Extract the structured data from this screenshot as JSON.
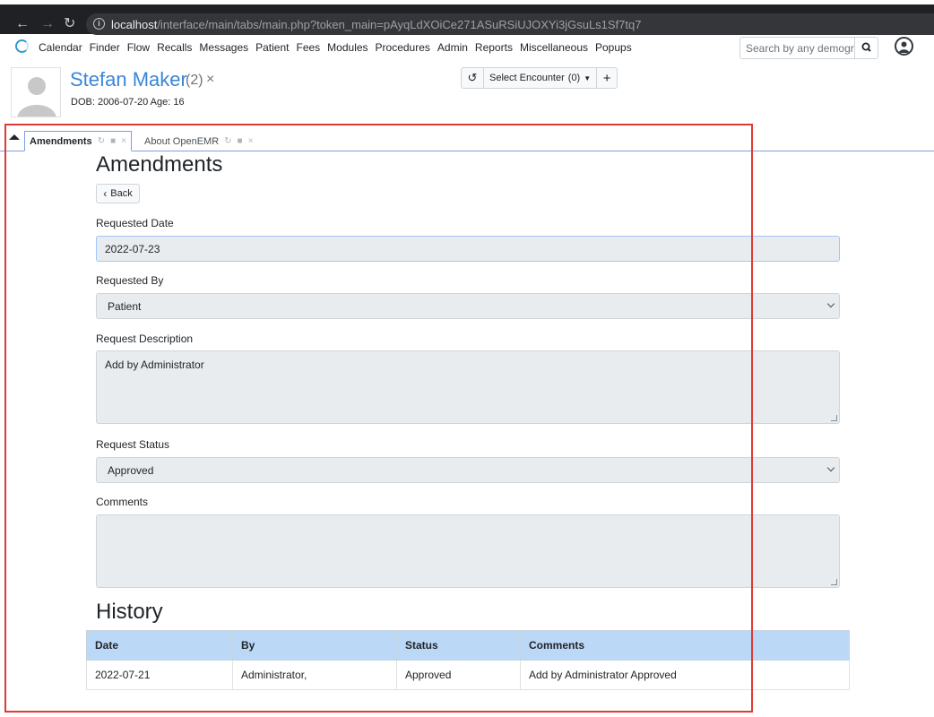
{
  "browser": {
    "url_host": "localhost",
    "url_path": "/interface/main/tabs/main.php?token_main=pAyqLdXOiCe271ASuRSiUJOXYi3jGsuLs1Sf7tq7"
  },
  "menu": {
    "items": [
      "Calendar",
      "Finder",
      "Flow",
      "Recalls",
      "Messages",
      "Patient",
      "Fees",
      "Modules",
      "Procedures",
      "Admin",
      "Reports",
      "Miscellaneous",
      "Popups"
    ],
    "search_placeholder": "Search by any demogra"
  },
  "patient": {
    "name": "Stefan Maker",
    "pid": "(2)",
    "close": "×",
    "dob_line": "DOB: 2006-07-20 Age: 16"
  },
  "encounter": {
    "select_label": "Select Encounter",
    "count": "(0)",
    "add": "+"
  },
  "tabs": [
    {
      "label": "Amendments",
      "active": true
    },
    {
      "label": "About OpenEMR",
      "active": false
    }
  ],
  "form": {
    "title": "Amendments",
    "back_label": "Back",
    "requested_date_label": "Requested Date",
    "requested_date_value": "2022-07-23",
    "requested_by_label": "Requested By",
    "requested_by_value": "Patient",
    "description_label": "Request Description",
    "description_value": "Add by Administrator",
    "status_label": "Request Status",
    "status_value": "Approved",
    "comments_label": "Comments",
    "comments_value": ""
  },
  "history": {
    "title": "History",
    "columns": [
      "Date",
      "By",
      "Status",
      "Comments"
    ],
    "rows": [
      [
        "2022-07-21",
        "Administrator,",
        "Approved",
        "Add by Administrator Approved"
      ]
    ]
  },
  "colors": {
    "accent": "#3a86d8",
    "table_header": "#bcd8f7",
    "annotation_box": "#e03a34"
  }
}
